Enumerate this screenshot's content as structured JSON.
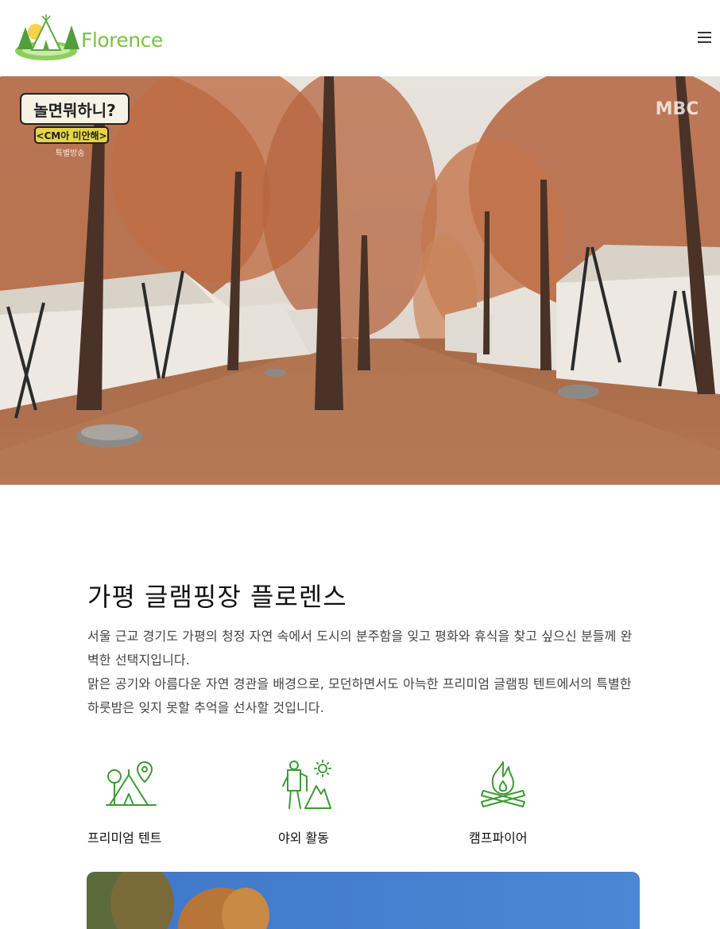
{
  "header": {
    "logo_text": "Florence",
    "menu_icon": "hamburger-menu-icon"
  },
  "hero": {
    "overlay_title": "놀면뭐하니?",
    "overlay_subtitle": "<CM아 미안해>",
    "overlay_note": "특별방송",
    "broadcaster": "MBC"
  },
  "intro": {
    "title": "가평 글램핑장 플로렌스",
    "paragraph1": "서울 근교 경기도 가평의 청정 자연 속에서 도시의 분주함을 잊고 평화와 휴식을 찾고 싶으신 분들께 완벽한 선택지입니다.",
    "paragraph2": "맑은 공기와 아름다운 자연 경관을 배경으로, 모던하면서도 아늑한 프리미엄 글램핑 텐트에서의 특별한 하룻밤은 잊지 못할 추억을 선사할 것입니다."
  },
  "features": [
    {
      "label": "프리미엄 텐트",
      "icon": "tent-location-icon"
    },
    {
      "label": "야외 활동",
      "icon": "hiker-icon"
    },
    {
      "label": "캠프파이어",
      "icon": "campfire-icon"
    }
  ],
  "colors": {
    "brand_green": "#7cc046",
    "icon_green": "#3f9a35",
    "text_dark": "#111111"
  }
}
